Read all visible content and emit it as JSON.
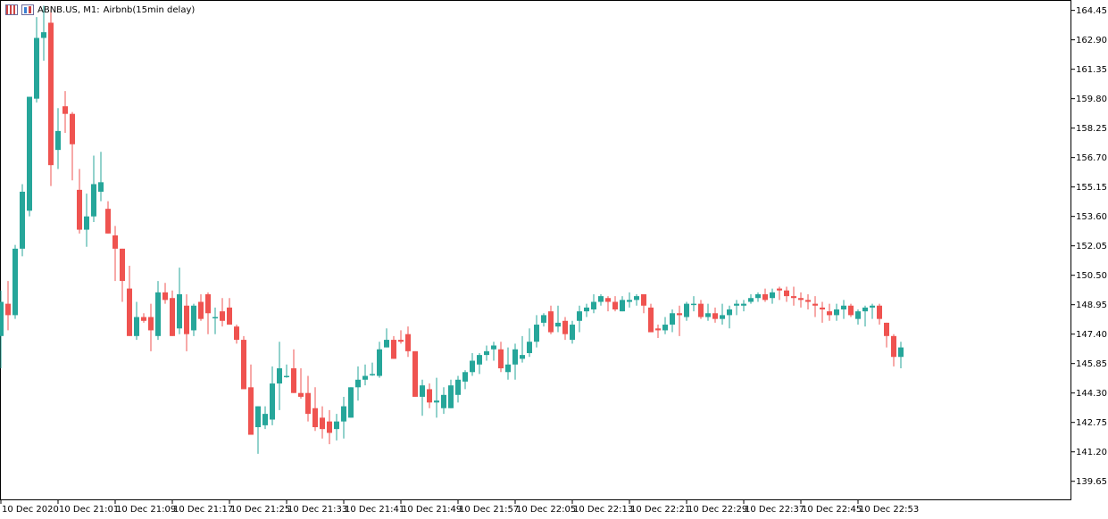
{
  "header": {
    "symbol": "ABNB.US, M1:",
    "description": "Airbnb(15min delay)"
  },
  "colors": {
    "bull": "#26a69a",
    "bear": "#ef5350",
    "axis": "#000000",
    "background": "#ffffff"
  },
  "chart_data": {
    "type": "candlestick",
    "title": "ABNB.US, M1:  Airbnb(15min delay)",
    "ylim": [
      138.65,
      164.95
    ],
    "y_ticks": [
      "164.45",
      "162.90",
      "161.35",
      "159.80",
      "158.25",
      "156.70",
      "155.15",
      "153.60",
      "152.05",
      "150.50",
      "148.95",
      "147.40",
      "145.85",
      "144.30",
      "142.75",
      "141.20",
      "139.65"
    ],
    "x_ticks": [
      "10 Dec 2020",
      "10 Dec 21:01",
      "10 Dec 21:09",
      "10 Dec 21:17",
      "10 Dec 21:25",
      "10 Dec 21:33",
      "10 Dec 21:41",
      "10 Dec 21:49",
      "10 Dec 21:57",
      "10 Dec 22:05",
      "10 Dec 22:13",
      "10 Dec 22:21",
      "10 Dec 22:29",
      "10 Dec 22:37",
      "10 Dec 22:45",
      "10 Dec 22:53"
    ],
    "x_tick_candle_index": [
      0,
      8,
      16,
      24,
      32,
      40,
      48,
      56,
      64,
      72,
      80,
      88,
      96,
      104,
      112,
      120
    ],
    "candles": [
      [
        147.3,
        149.7,
        145.6,
        149.1
      ],
      [
        149.0,
        150.2,
        147.6,
        148.4
      ],
      [
        148.4,
        152.1,
        148.2,
        151.9
      ],
      [
        151.9,
        155.3,
        151.5,
        154.9
      ],
      [
        153.9,
        158.1,
        153.6,
        159.9
      ],
      [
        159.8,
        164.1,
        159.6,
        163.0
      ],
      [
        163.0,
        164.7,
        161.8,
        163.3
      ],
      [
        163.8,
        164.5,
        155.2,
        156.3
      ],
      [
        157.1,
        159.3,
        156.1,
        158.1
      ],
      [
        159.4,
        160.2,
        158.0,
        159.0
      ],
      [
        159.0,
        159.1,
        155.5,
        157.4
      ],
      [
        155.0,
        156.1,
        152.7,
        152.9
      ],
      [
        152.9,
        154.8,
        152.0,
        153.6
      ],
      [
        153.6,
        156.8,
        153.3,
        155.3
      ],
      [
        154.9,
        157.0,
        154.4,
        155.4
      ],
      [
        154.0,
        154.4,
        152.9,
        152.7
      ],
      [
        152.6,
        153.1,
        150.2,
        151.9
      ],
      [
        151.9,
        151.7,
        149.1,
        150.2
      ],
      [
        149.8,
        151.0,
        148.3,
        147.3
      ],
      [
        147.3,
        149.1,
        147.1,
        148.3
      ],
      [
        148.3,
        148.5,
        148.0,
        148.1
      ],
      [
        148.3,
        149.0,
        146.5,
        147.6
      ],
      [
        147.3,
        150.2,
        147.1,
        149.6
      ],
      [
        149.6,
        150.1,
        149.0,
        149.2
      ],
      [
        149.3,
        149.7,
        148.8,
        147.3
      ],
      [
        147.7,
        150.9,
        147.4,
        149.5
      ],
      [
        148.9,
        149.5,
        146.5,
        147.4
      ],
      [
        147.6,
        149.0,
        147.3,
        148.9
      ],
      [
        149.1,
        149.5,
        148.1,
        148.2
      ],
      [
        149.5,
        149.6,
        147.4,
        148.5
      ],
      [
        148.3,
        148.8,
        147.4,
        148.3
      ],
      [
        148.6,
        149.3,
        147.8,
        148.1
      ],
      [
        148.8,
        149.3,
        147.9,
        147.9
      ],
      [
        147.8,
        147.9,
        146.9,
        147.1
      ],
      [
        147.1,
        147.3,
        145.8,
        144.5
      ],
      [
        144.6,
        145.8,
        142.4,
        142.1
      ],
      [
        142.5,
        143.3,
        141.1,
        143.6
      ],
      [
        142.6,
        143.6,
        142.4,
        143.2
      ],
      [
        142.9,
        145.7,
        142.6,
        144.8
      ],
      [
        144.8,
        147.0,
        143.4,
        145.6
      ],
      [
        145.2,
        145.8,
        145.1,
        145.2
      ],
      [
        145.6,
        146.6,
        144.8,
        144.3
      ],
      [
        144.3,
        145.6,
        144.0,
        144.1
      ],
      [
        144.3,
        145.2,
        142.8,
        143.2
      ],
      [
        143.5,
        144.6,
        142.3,
        142.5
      ],
      [
        143.0,
        143.6,
        141.9,
        142.4
      ],
      [
        142.8,
        143.4,
        141.6,
        142.2
      ],
      [
        142.4,
        143.2,
        141.8,
        142.8
      ],
      [
        142.8,
        144.1,
        141.9,
        143.6
      ],
      [
        143.0,
        144.6,
        143.1,
        144.6
      ],
      [
        144.6,
        145.7,
        143.9,
        145.0
      ],
      [
        145.0,
        145.8,
        144.7,
        145.2
      ],
      [
        145.3,
        145.9,
        145.2,
        145.3
      ],
      [
        145.2,
        147.0,
        145.1,
        146.6
      ],
      [
        146.7,
        147.7,
        146.7,
        147.1
      ],
      [
        147.1,
        147.3,
        146.4,
        146.1
      ],
      [
        147.1,
        147.6,
        146.9,
        147.0
      ],
      [
        147.4,
        147.8,
        146.2,
        146.5
      ],
      [
        146.5,
        145.8,
        144.9,
        144.1
      ],
      [
        144.1,
        145.0,
        143.1,
        144.7
      ],
      [
        144.5,
        144.8,
        143.5,
        143.8
      ],
      [
        143.8,
        145.1,
        143.0,
        143.9
      ],
      [
        143.5,
        144.6,
        143.2,
        144.2
      ],
      [
        143.5,
        145.0,
        143.5,
        144.7
      ],
      [
        144.2,
        145.2,
        143.8,
        145.0
      ],
      [
        144.9,
        145.5,
        144.5,
        145.4
      ],
      [
        145.4,
        146.4,
        145.2,
        146.0
      ],
      [
        145.8,
        146.4,
        145.3,
        146.3
      ],
      [
        146.3,
        146.8,
        146.0,
        146.5
      ],
      [
        146.6,
        147.0,
        146.0,
        146.8
      ],
      [
        146.6,
        147.0,
        145.4,
        145.6
      ],
      [
        145.4,
        146.7,
        145.0,
        145.8
      ],
      [
        145.8,
        146.9,
        145.0,
        146.6
      ],
      [
        146.1,
        147.3,
        145.9,
        146.3
      ],
      [
        146.4,
        147.7,
        146.2,
        147.0
      ],
      [
        147.0,
        148.4,
        146.7,
        147.9
      ],
      [
        148.0,
        148.5,
        147.8,
        148.4
      ],
      [
        148.6,
        148.9,
        147.4,
        147.5
      ],
      [
        147.8,
        148.9,
        147.5,
        148.0
      ],
      [
        148.1,
        148.3,
        147.1,
        147.4
      ],
      [
        147.1,
        148.1,
        146.9,
        147.9
      ],
      [
        148.1,
        148.9,
        147.5,
        148.6
      ],
      [
        148.6,
        149.0,
        148.3,
        148.8
      ],
      [
        148.7,
        149.5,
        148.5,
        149.1
      ],
      [
        149.1,
        149.5,
        148.9,
        149.4
      ],
      [
        149.3,
        149.4,
        148.6,
        149.1
      ],
      [
        149.1,
        149.4,
        148.6,
        148.7
      ],
      [
        148.6,
        149.4,
        148.6,
        149.2
      ],
      [
        149.1,
        149.6,
        148.8,
        149.2
      ],
      [
        149.2,
        149.5,
        148.9,
        149.4
      ],
      [
        149.5,
        149.5,
        148.5,
        148.9
      ],
      [
        148.8,
        149.0,
        147.7,
        147.5
      ],
      [
        147.7,
        147.9,
        147.2,
        147.6
      ],
      [
        147.6,
        148.3,
        147.4,
        147.9
      ],
      [
        147.9,
        148.7,
        147.5,
        148.5
      ],
      [
        148.5,
        148.9,
        147.3,
        148.4
      ],
      [
        148.3,
        149.1,
        148.1,
        149.0
      ],
      [
        149.0,
        149.4,
        148.6,
        149.0
      ],
      [
        149.0,
        149.2,
        148.2,
        148.3
      ],
      [
        148.3,
        149.0,
        148.1,
        148.5
      ],
      [
        148.5,
        148.8,
        148.0,
        148.2
      ],
      [
        148.2,
        149.0,
        147.9,
        148.4
      ],
      [
        148.4,
        148.9,
        147.7,
        148.7
      ],
      [
        148.9,
        149.2,
        148.4,
        149.0
      ],
      [
        148.9,
        149.2,
        148.6,
        149.0
      ],
      [
        149.1,
        149.5,
        149.0,
        149.3
      ],
      [
        149.3,
        149.6,
        149.1,
        149.5
      ],
      [
        149.5,
        149.8,
        149.1,
        149.2
      ],
      [
        149.3,
        149.8,
        149.0,
        149.6
      ],
      [
        149.8,
        149.9,
        149.2,
        149.7
      ],
      [
        149.7,
        149.9,
        149.1,
        149.4
      ],
      [
        149.4,
        149.9,
        148.9,
        149.3
      ],
      [
        149.3,
        149.6,
        148.8,
        149.2
      ],
      [
        149.2,
        149.5,
        148.7,
        149.1
      ],
      [
        149.0,
        149.4,
        148.3,
        148.9
      ],
      [
        148.8,
        149.1,
        148.0,
        148.7
      ],
      [
        148.6,
        149.0,
        148.1,
        148.4
      ],
      [
        148.4,
        149.0,
        148.1,
        148.7
      ],
      [
        148.7,
        149.2,
        148.2,
        148.9
      ],
      [
        148.9,
        149.0,
        148.3,
        148.4
      ],
      [
        148.2,
        148.7,
        147.9,
        148.6
      ],
      [
        148.6,
        148.9,
        147.8,
        148.8
      ],
      [
        148.8,
        149.0,
        148.2,
        148.9
      ],
      [
        148.9,
        149.0,
        147.9,
        148.2
      ],
      [
        148.0,
        148.0,
        146.7,
        147.3
      ],
      [
        147.3,
        147.4,
        145.7,
        146.2
      ],
      [
        146.2,
        147.0,
        145.6,
        146.7
      ]
    ]
  }
}
